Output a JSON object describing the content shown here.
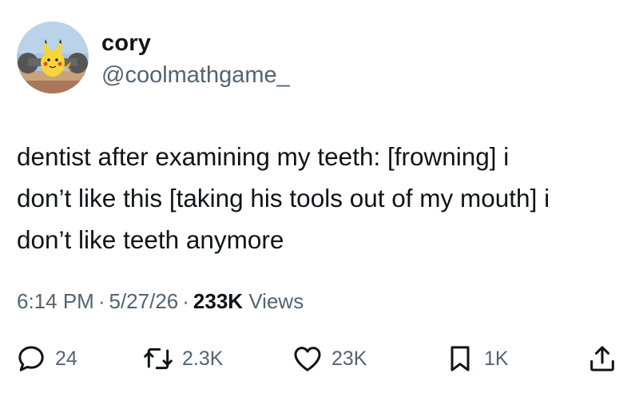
{
  "author": {
    "display_name": "cory",
    "handle": "@coolmathgame_",
    "avatar_icon": "pikachu-avatar-icon"
  },
  "tweet": {
    "text": "dentist after examining my teeth: [frowning] i\ndon’t like this [taking his tools out of my mouth] i\ndon’t like teeth anymore"
  },
  "meta": {
    "time": "6:14 PM",
    "separator": "·",
    "date": "5/27/26",
    "views_count": "233K",
    "views_label": "Views"
  },
  "actions": {
    "replies": "24",
    "retweets": "2.3K",
    "likes": "23K",
    "bookmarks": "1K"
  },
  "colors": {
    "text": "#0f1419",
    "secondary": "#536471"
  }
}
